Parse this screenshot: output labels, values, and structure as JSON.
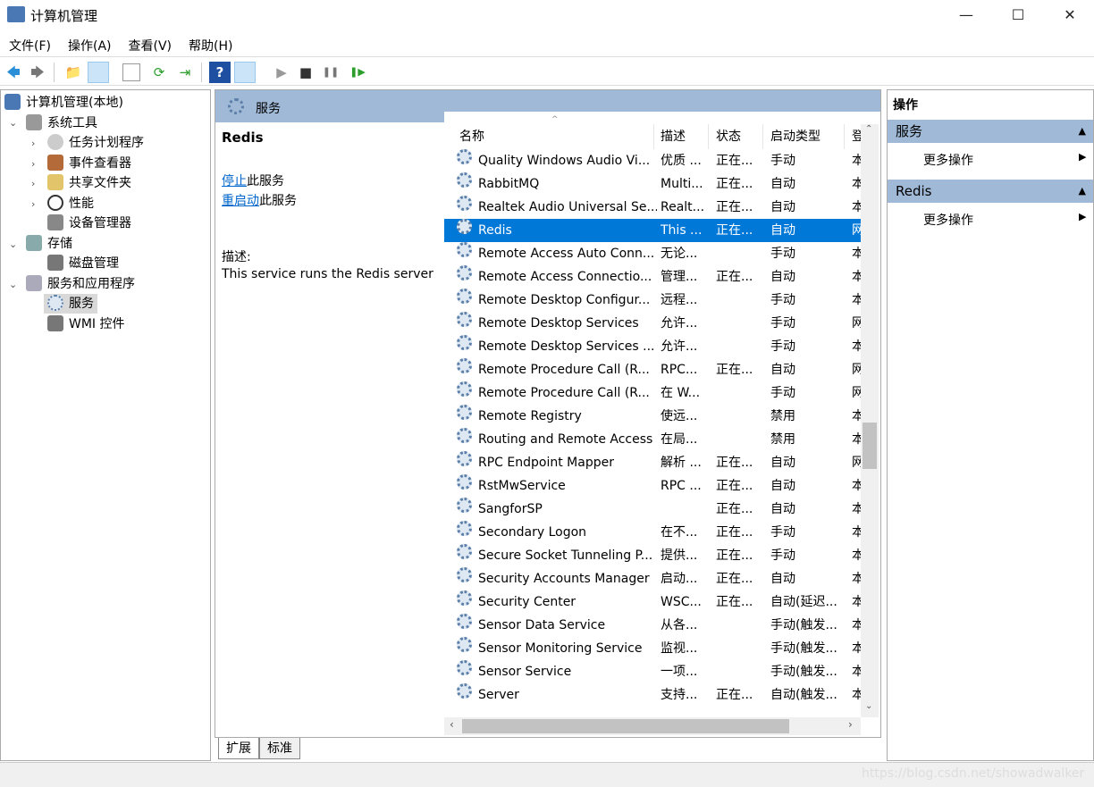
{
  "window": {
    "title": "计算机管理",
    "min": "—",
    "max": "☐",
    "close": "✕"
  },
  "menu": [
    "文件(F)",
    "操作(A)",
    "查看(V)",
    "帮助(H)"
  ],
  "toolbar": {
    "back": "🡄",
    "forward": "🡆",
    "up": "📁",
    "help": "?",
    "play": "▶",
    "stop": "■",
    "pause": "❚❚",
    "resume": "❚▶"
  },
  "tree": {
    "root": "计算机管理(本地)",
    "system_tools": "系统工具",
    "task_scheduler": "任务计划程序",
    "event_viewer": "事件查看器",
    "shared_folders": "共享文件夹",
    "performance": "性能",
    "device_manager": "设备管理器",
    "storage": "存储",
    "disk_management": "磁盘管理",
    "services_apps": "服务和应用程序",
    "services": "服务",
    "wmi": "WMI 控件"
  },
  "middle": {
    "header": "服务",
    "selected_name": "Redis",
    "stop_link": "停止",
    "stop_suffix": "此服务",
    "restart_link": "重启动",
    "restart_suffix": "此服务",
    "desc_label": "描述:",
    "desc_text": "This service runs the Redis server"
  },
  "columns": [
    "名称",
    "描述",
    "状态",
    "启动类型",
    "登"
  ],
  "rows": [
    [
      "Quality Windows Audio Vi...",
      "优质 ...",
      "正在...",
      "手动",
      "本"
    ],
    [
      "RabbitMQ",
      "Multi...",
      "正在...",
      "自动",
      "本"
    ],
    [
      "Realtek Audio Universal Se...",
      "Realt...",
      "正在...",
      "自动",
      "本"
    ],
    [
      "Redis",
      "This ...",
      "正在...",
      "自动",
      "网"
    ],
    [
      "Remote Access Auto Conn...",
      "无论...",
      "",
      "手动",
      "本"
    ],
    [
      "Remote Access Connectio...",
      "管理...",
      "正在...",
      "自动",
      "本"
    ],
    [
      "Remote Desktop Configur...",
      "远程...",
      "",
      "手动",
      "本"
    ],
    [
      "Remote Desktop Services",
      "允许...",
      "",
      "手动",
      "网"
    ],
    [
      "Remote Desktop Services ...",
      "允许...",
      "",
      "手动",
      "本"
    ],
    [
      "Remote Procedure Call (R...",
      "RPC...",
      "正在...",
      "自动",
      "网"
    ],
    [
      "Remote Procedure Call (R...",
      "在 W...",
      "",
      "手动",
      "网"
    ],
    [
      "Remote Registry",
      "使远...",
      "",
      "禁用",
      "本"
    ],
    [
      "Routing and Remote Access",
      "在局...",
      "",
      "禁用",
      "本"
    ],
    [
      "RPC Endpoint Mapper",
      "解析 ...",
      "正在...",
      "自动",
      "网"
    ],
    [
      "RstMwService",
      "RPC ...",
      "正在...",
      "自动",
      "本"
    ],
    [
      "SangforSP",
      "",
      "正在...",
      "自动",
      "本"
    ],
    [
      "Secondary Logon",
      "在不...",
      "正在...",
      "手动",
      "本"
    ],
    [
      "Secure Socket Tunneling P...",
      "提供...",
      "正在...",
      "手动",
      "本"
    ],
    [
      "Security Accounts Manager",
      "启动...",
      "正在...",
      "自动",
      "本"
    ],
    [
      "Security Center",
      "WSC...",
      "正在...",
      "自动(延迟...",
      "本"
    ],
    [
      "Sensor Data Service",
      "从各...",
      "",
      "手动(触发...",
      "本"
    ],
    [
      "Sensor Monitoring Service",
      "监视...",
      "",
      "手动(触发...",
      "本"
    ],
    [
      "Sensor Service",
      "一项...",
      "",
      "手动(触发...",
      "本"
    ],
    [
      "Server",
      "支持...",
      "正在...",
      "自动(触发...",
      "本"
    ]
  ],
  "selected_row": 3,
  "tabs": [
    "扩展",
    "标准"
  ],
  "actions": {
    "title": "操作",
    "section1": "服务",
    "more1": "更多操作",
    "section2": "Redis",
    "more2": "更多操作"
  },
  "watermark": "https://blog.csdn.net/showadwalker",
  "colors": {
    "selection": "#0078d7",
    "header_band": "#9fb9d6",
    "link": "#0066cc"
  }
}
